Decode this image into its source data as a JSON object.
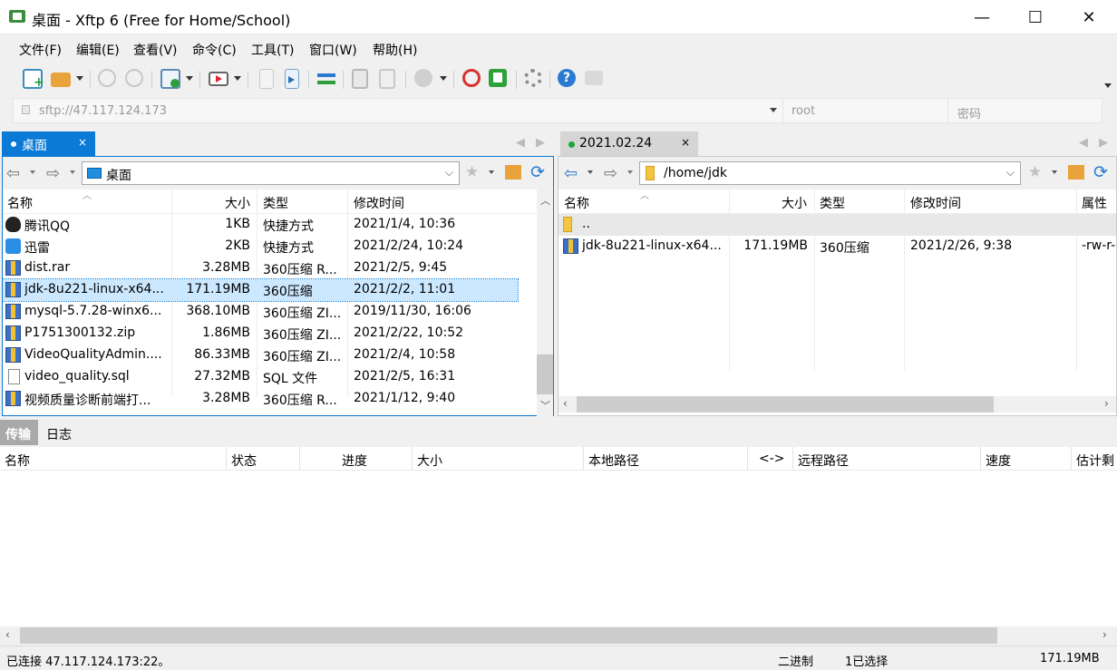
{
  "window": {
    "title": "桌面 - Xftp 6 (Free for Home/School)",
    "controls": [
      "—",
      "☐",
      "✕"
    ]
  },
  "menu": [
    "文件(F)",
    "编辑(E)",
    "查看(V)",
    "命令(C)",
    "工具(T)",
    "窗口(W)",
    "帮助(H)"
  ],
  "address": {
    "url": "sftp://47.117.124.173",
    "user": "root",
    "password_placeholder": "密码"
  },
  "local": {
    "tab": "桌面",
    "path": "桌面",
    "columns": [
      "名称",
      "大小",
      "类型",
      "修改时间"
    ],
    "files": [
      {
        "name": "腾讯QQ",
        "size": "1KB",
        "type": "快捷方式",
        "mtime": "2021/1/4, 10:36",
        "icon": "qq-icon"
      },
      {
        "name": "迅雷",
        "size": "2KB",
        "type": "快捷方式",
        "mtime": "2021/2/24, 10:24",
        "icon": "thunder-icon"
      },
      {
        "name": "dist.rar",
        "size": "3.28MB",
        "type": "360压缩 R...",
        "mtime": "2021/2/5, 9:45",
        "icon": "archive-icon"
      },
      {
        "name": "jdk-8u221-linux-x64...",
        "size": "171.19MB",
        "type": "360压缩",
        "mtime": "2021/2/2, 11:01",
        "icon": "archive-icon",
        "selected": true
      },
      {
        "name": "mysql-5.7.28-winx6...",
        "size": "368.10MB",
        "type": "360压缩 ZI...",
        "mtime": "2019/11/30, 16:06",
        "icon": "archive-icon"
      },
      {
        "name": "P1751300132.zip",
        "size": "1.86MB",
        "type": "360压缩 ZI...",
        "mtime": "2021/2/22, 10:52",
        "icon": "archive-icon"
      },
      {
        "name": "VideoQualityAdmin....",
        "size": "86.33MB",
        "type": "360压缩 ZI...",
        "mtime": "2021/2/4, 10:58",
        "icon": "archive-icon"
      },
      {
        "name": "video_quality.sql",
        "size": "27.32MB",
        "type": "SQL 文件",
        "mtime": "2021/2/5, 16:31",
        "icon": "document-icon"
      },
      {
        "name": "视频质量诊断前端打...",
        "size": "3.28MB",
        "type": "360压缩 R...",
        "mtime": "2021/1/12, 9:40",
        "icon": "archive-icon"
      }
    ]
  },
  "remote": {
    "tab": "2021.02.24",
    "path": "/home/jdk",
    "columns": [
      "名称",
      "大小",
      "类型",
      "修改时间",
      "属性"
    ],
    "files": [
      {
        "name": "..",
        "size": "",
        "type": "",
        "mtime": "",
        "attr": "",
        "icon": "folder-icon"
      },
      {
        "name": "jdk-8u221-linux-x64...",
        "size": "171.19MB",
        "type": "360压缩",
        "mtime": "2021/2/26, 9:38",
        "attr": "-rw-r-",
        "icon": "archive-icon"
      }
    ]
  },
  "transfer": {
    "tabs": [
      "传输",
      "日志"
    ],
    "columns": [
      "名称",
      "状态",
      "进度",
      "大小",
      "本地路径",
      "<->",
      "远程路径",
      "速度",
      "估计剩"
    ]
  },
  "status": {
    "connection": "已连接 47.117.124.173:22。",
    "mode": "二进制",
    "selection": "1已选择",
    "size": "171.19MB"
  },
  "colors": {
    "accent": "#0a7ad6",
    "selection": "#cce8ff"
  }
}
